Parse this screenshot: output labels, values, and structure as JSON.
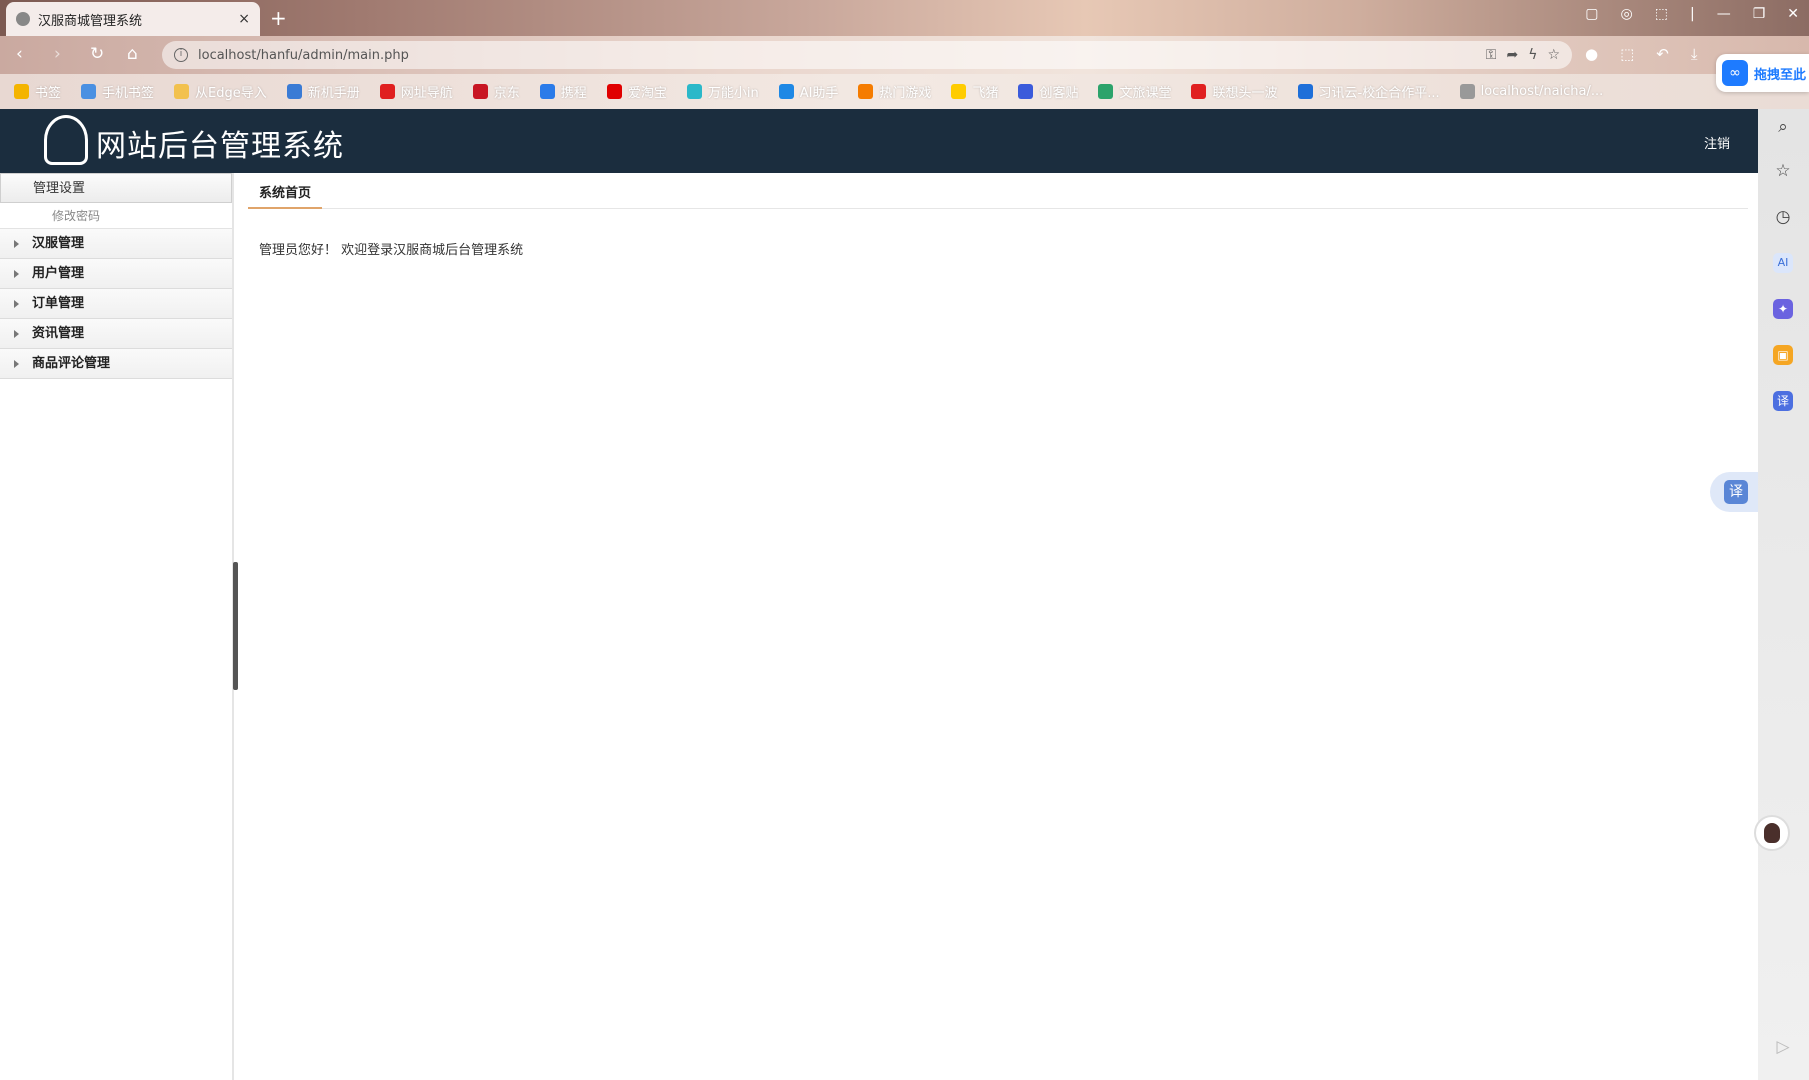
{
  "browser": {
    "tab_title": "汉服商城管理系统",
    "tab_close": "×",
    "new_tab": "+",
    "url": "localhost/hanfu/admin/main.php",
    "bookmarks": [
      {
        "label": "书签",
        "color": "#f4b400"
      },
      {
        "label": "手机书签",
        "color": "#4a90e2"
      },
      {
        "label": "从Edge导入",
        "color": "#f2c14e"
      },
      {
        "label": "新机手册",
        "color": "#3a7bd5"
      },
      {
        "label": "网址导航",
        "color": "#e02020"
      },
      {
        "label": "京东",
        "color": "#c81623"
      },
      {
        "label": "携程",
        "color": "#2b7be9"
      },
      {
        "label": "爱淘宝",
        "color": "#e00000"
      },
      {
        "label": "万能小in",
        "color": "#2bb8c9"
      },
      {
        "label": "AI助手",
        "color": "#1e88e5"
      },
      {
        "label": "热门游戏",
        "color": "#f57c00"
      },
      {
        "label": "飞猪",
        "color": "#ffcc00"
      },
      {
        "label": "创客贴",
        "color": "#3b5bdb"
      },
      {
        "label": "文旅课堂",
        "color": "#2ca36b"
      },
      {
        "label": "联想头一波",
        "color": "#e02020"
      },
      {
        "label": "习讯云-校企合作平...",
        "color": "#1e6fd9"
      },
      {
        "label": "localhost/naicha/...",
        "color": "#999999"
      }
    ],
    "baidu_pill_text": "拖拽至此"
  },
  "header": {
    "site_title": "网站后台管理系统",
    "logout_label": "注销"
  },
  "sidebar": {
    "group_label": "管理设置",
    "sub_items": [
      "修改密码"
    ],
    "menu_items": [
      "汉服管理",
      "用户管理",
      "订单管理",
      "资讯管理",
      "商品评论管理"
    ]
  },
  "main": {
    "tab_label": "系统首页",
    "welcome_text": "管理员您好！ 欢迎登录汉服商城后台管理系统"
  },
  "right_sidebar": {
    "translate_label": "译"
  }
}
